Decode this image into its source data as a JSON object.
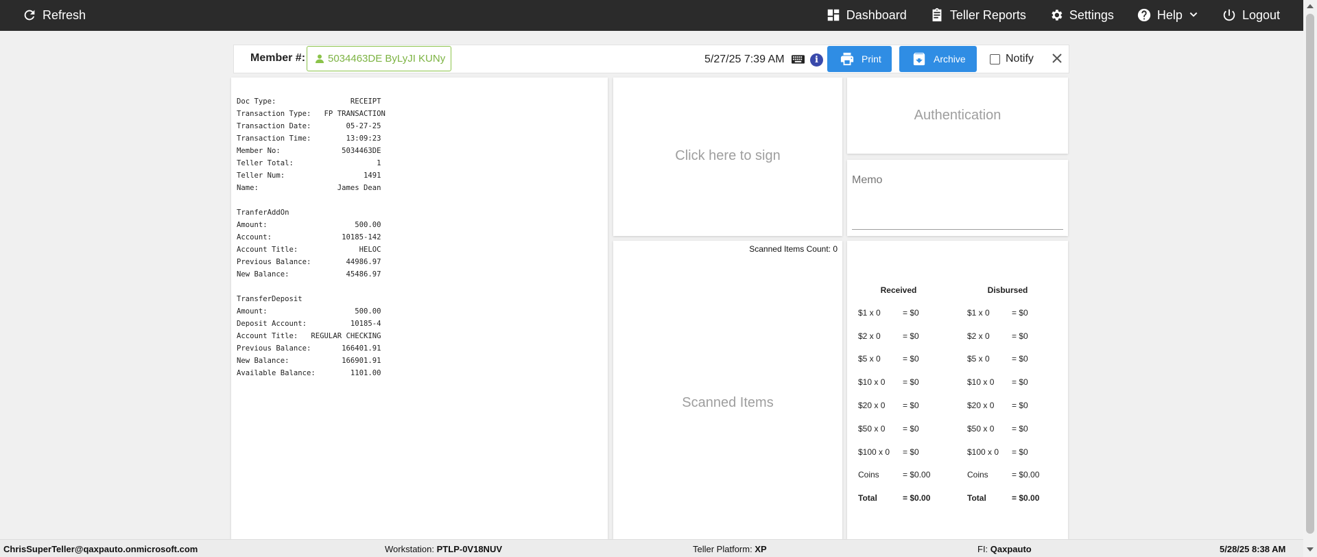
{
  "topbar": {
    "refresh_label": "Refresh",
    "dashboard_label": "Dashboard",
    "teller_reports_label": "Teller Reports",
    "settings_label": "Settings",
    "help_label": "Help",
    "logout_label": "Logout"
  },
  "header": {
    "member_label": "Member #:",
    "member_value": "5034463DE ByLyJI KUNy",
    "datetime": "5/27/25 7:39 AM",
    "info_label": "i",
    "print_label": "Print",
    "archive_label": "Archive",
    "notify_label": "Notify"
  },
  "receipt": {
    "lines": [
      "Doc Type:                 RECEIPT",
      "Transaction Type:   FP TRANSACTION",
      "Transaction Date:        05-27-25",
      "Transaction Time:        13:09:23",
      "Member No:              5034463DE",
      "Teller Total:                   1",
      "Teller Num:                  1491",
      "Name:                  James Dean",
      "",
      "TranferAddOn",
      "Amount:                    500.00",
      "Account:                10185-142",
      "Account Title:              HELOC",
      "Previous Balance:        44986.97",
      "New Balance:             45486.97",
      "",
      "TransferDeposit",
      "Amount:                    500.00",
      "Deposit Account:          10185-4",
      "Account Title:   REGULAR CHECKING",
      "Previous Balance:       166401.91",
      "New Balance:            166901.91",
      "Available Balance:        1101.00"
    ]
  },
  "signature": {
    "placeholder": "Click here to sign"
  },
  "authentication": {
    "label": "Authentication"
  },
  "memo": {
    "label": "Memo"
  },
  "scanned": {
    "count_text": "Scanned Items Count: 0",
    "placeholder": "Scanned Items"
  },
  "cash": {
    "received": {
      "title": "Received",
      "rows": [
        {
          "denom": "$1 x 0",
          "total": "= $0"
        },
        {
          "denom": "$2 x 0",
          "total": "= $0"
        },
        {
          "denom": "$5 x 0",
          "total": "= $0"
        },
        {
          "denom": "$10 x 0",
          "total": "= $0"
        },
        {
          "denom": "$20 x 0",
          "total": "= $0"
        },
        {
          "denom": "$50 x 0",
          "total": "= $0"
        },
        {
          "denom": "$100 x 0",
          "total": "= $0"
        },
        {
          "denom": "Coins",
          "total": "= $0.00"
        },
        {
          "denom": "Total",
          "total": "= $0.00"
        }
      ]
    },
    "disbursed": {
      "title": "Disbursed",
      "rows": [
        {
          "denom": "$1 x 0",
          "total": "= $0"
        },
        {
          "denom": "$2 x 0",
          "total": "= $0"
        },
        {
          "denom": "$5 x 0",
          "total": "= $0"
        },
        {
          "denom": "$10 x 0",
          "total": "= $0"
        },
        {
          "denom": "$20 x 0",
          "total": "= $0"
        },
        {
          "denom": "$50 x 0",
          "total": "= $0"
        },
        {
          "denom": "$100 x 0",
          "total": "= $0"
        },
        {
          "denom": "Coins",
          "total": "= $0.00"
        },
        {
          "denom": "Total",
          "total": "= $0.00"
        }
      ]
    }
  },
  "footer": {
    "user": "ChrisSuperTeller@qaxpauto.onmicrosoft.com",
    "workstation_label": "Workstation:",
    "workstation_value": "PTLP-0V18NUV",
    "platform_label": "Teller Platform:",
    "platform_value": "XP",
    "fi_label": "FI:",
    "fi_value": "Qaxpauto",
    "datetime": "5/28/25 8:38 AM"
  },
  "colors": {
    "topbar": "#2b2b2b",
    "button_blue": "#2f8de4",
    "member_green": "#8bc34a"
  }
}
